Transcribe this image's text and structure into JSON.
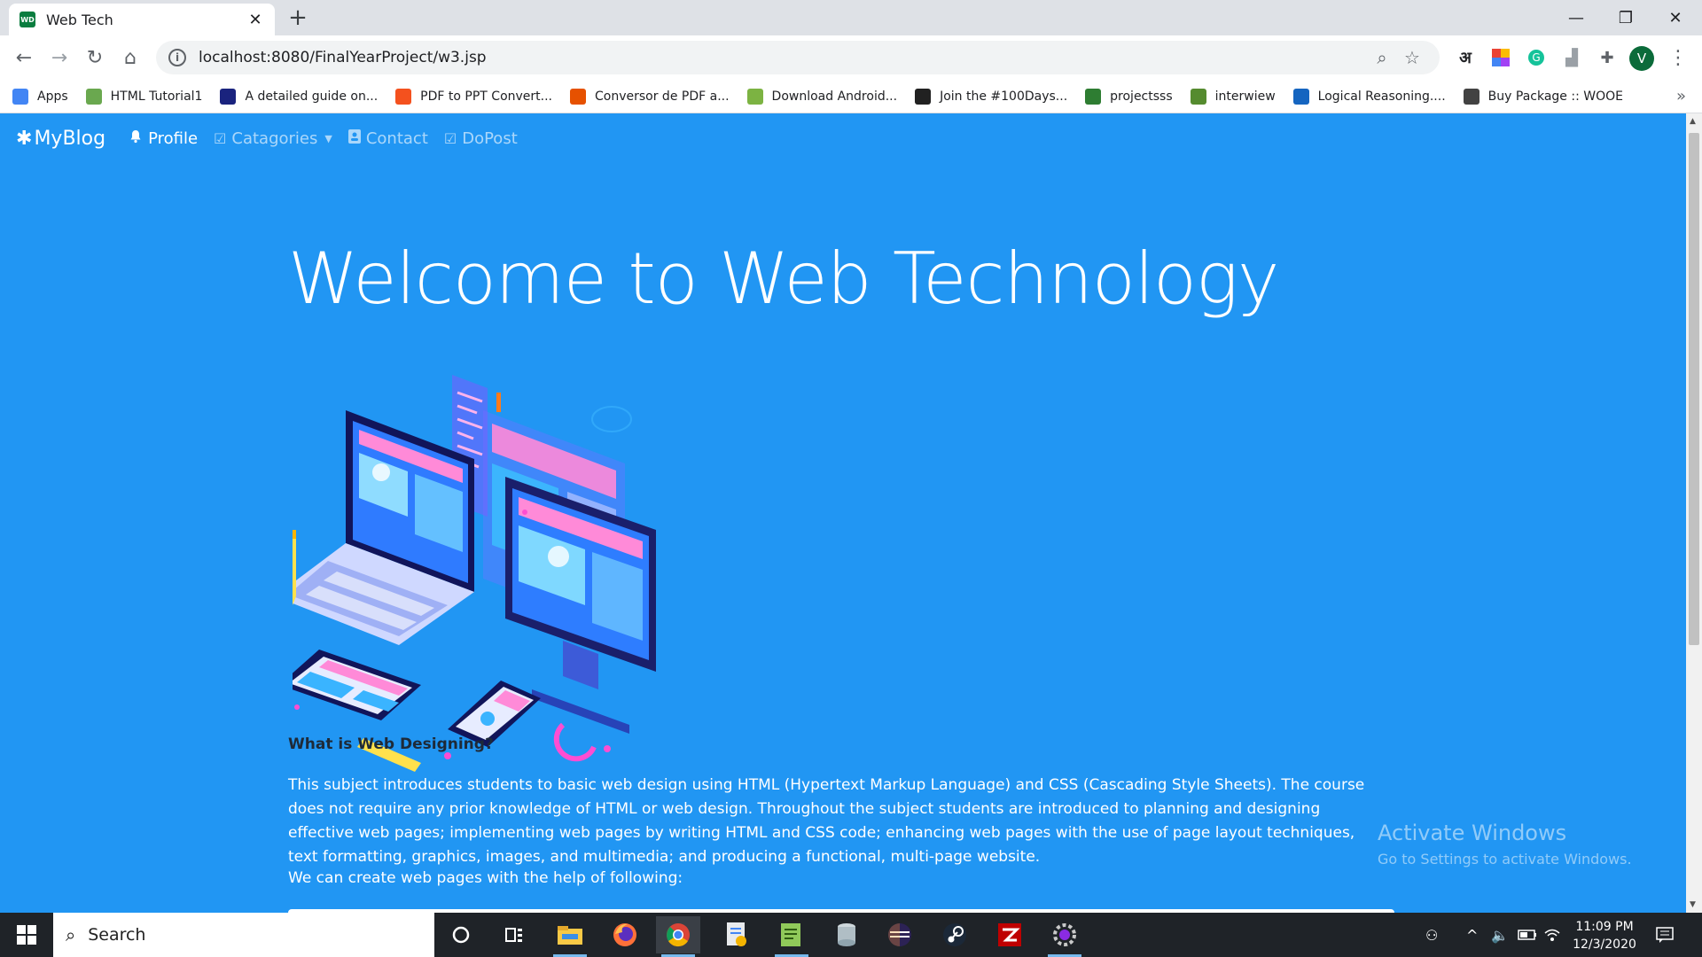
{
  "browser": {
    "tab_title": "Web Tech",
    "favicon_text": "WD",
    "url": "localhost:8080/FinalYearProject/w3.jsp",
    "profile_initial": "V",
    "hindi_ext": "अ"
  },
  "bookmarks": [
    {
      "label": "Apps",
      "color": "#4285f4"
    },
    {
      "label": "HTML Tutorial1",
      "color": "#6aa84f"
    },
    {
      "label": "A detailed guide on...",
      "color": "#1a237e"
    },
    {
      "label": "PDF to PPT Convert...",
      "color": "#f4511e"
    },
    {
      "label": "Conversor de PDF a...",
      "color": "#e65100"
    },
    {
      "label": "Download Android...",
      "color": "#7cb342"
    },
    {
      "label": "Join the #100Days...",
      "color": "#212121"
    },
    {
      "label": "projectsss",
      "color": "#2e7d32"
    },
    {
      "label": "interwiew",
      "color": "#558b2f"
    },
    {
      "label": "Logical Reasoning....",
      "color": "#1565c0"
    },
    {
      "label": "Buy Package :: WOOE",
      "color": "#424242"
    }
  ],
  "site": {
    "brand": "MyBlog",
    "nav": [
      {
        "label": "Profile",
        "icon": "bell-icon"
      },
      {
        "label": "Catagories",
        "icon": "check-square-icon"
      },
      {
        "label": "Contact",
        "icon": "contact-card-icon"
      },
      {
        "label": "DoPost",
        "icon": "check-square-icon"
      }
    ],
    "hero_title": "Welcome to Web Technology",
    "section_heading": "What is Web Designing?",
    "paragraph": "This subject introduces students to basic web design using HTML (Hypertext Markup Language) and CSS (Cascading Style Sheets). The course does not require any prior knowledge of HTML or web design. Throughout the subject students are introduced to planning and designing effective web pages; implementing web pages by writing HTML and CSS code; enhancing web pages with the use of page layout techniques, text formatting, graphics, images, and multimedia; and producing a functional, multi-page website.",
    "paragraph_last": "We can create web pages with the help of following:",
    "bg_color": "#2196f3"
  },
  "watermark": {
    "title": "Activate Windows",
    "subtitle": "Go to Settings to activate Windows."
  },
  "taskbar": {
    "search_text": "Search",
    "time": "11:09 PM",
    "date": "12/3/2020"
  }
}
